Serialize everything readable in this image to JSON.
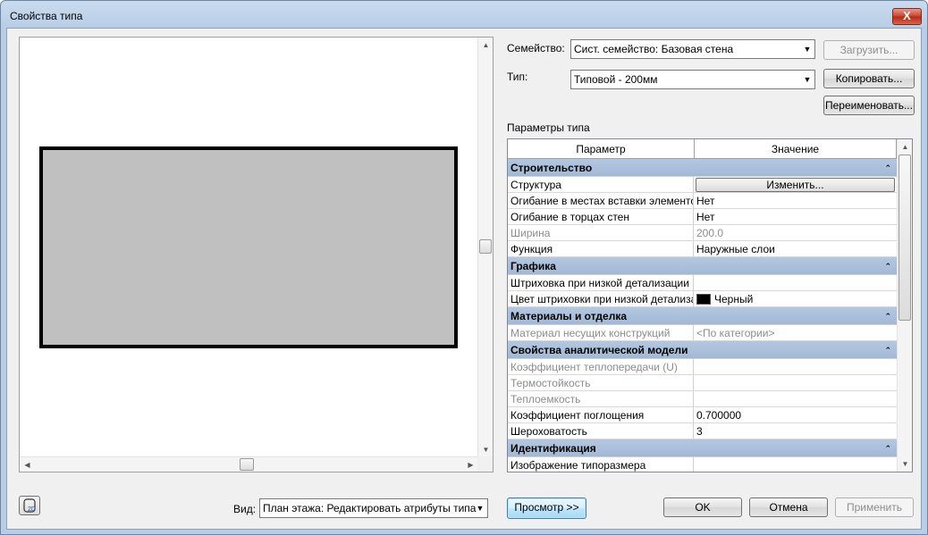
{
  "window": {
    "title": "Свойства типа",
    "close_glyph": "X"
  },
  "left": {
    "view_label": "Вид:",
    "view_value": "План этажа: Редактировать атрибуты типа",
    "preview_button": "Просмотр >>"
  },
  "right": {
    "family_label": "Семейство:",
    "family_value": "Сист. семейство: Базовая стена",
    "load_button": "Загрузить...",
    "type_label": "Тип:",
    "type_value": "Типовой - 200мм",
    "copy_button": "Копировать...",
    "rename_button": "Переименовать...",
    "params_label": "Параметры типа"
  },
  "grid": {
    "col_param": "Параметр",
    "col_value": "Значение",
    "groups": [
      {
        "title": "Строительство",
        "rows": [
          {
            "name": "Структура",
            "value": "Изменить...",
            "button": true
          },
          {
            "name": "Огибание в местах вставки элементов",
            "value": "Нет"
          },
          {
            "name": "Огибание в торцах стен",
            "value": "Нет"
          },
          {
            "name": "Ширина",
            "value": "200.0",
            "disabled": true
          },
          {
            "name": "Функция",
            "value": "Наружные слои"
          }
        ]
      },
      {
        "title": "Графика",
        "rows": [
          {
            "name": "Штриховка при низкой детализации",
            "value": ""
          },
          {
            "name": "Цвет штриховки при низкой детализации",
            "value": "Черный",
            "swatch": true
          }
        ]
      },
      {
        "title": "Материалы и отделка",
        "rows": [
          {
            "name": "Материал несущих конструкций",
            "value": "<По категории>",
            "disabled": true
          }
        ]
      },
      {
        "title": "Свойства аналитической модели",
        "rows": [
          {
            "name": "Коэффициент теплопередачи (U)",
            "value": "",
            "disabled": true
          },
          {
            "name": "Термостойкость",
            "value": "",
            "disabled": true
          },
          {
            "name": "Теплоемкость",
            "value": "",
            "disabled": true
          },
          {
            "name": "Коэффициент поглощения",
            "value": "0.700000"
          },
          {
            "name": "Шероховатость",
            "value": "3"
          }
        ]
      },
      {
        "title": "Идентификация",
        "rows": [
          {
            "name": "Изображение типоразмера",
            "value": ""
          }
        ]
      }
    ]
  },
  "footer": {
    "ok": "OK",
    "cancel": "Отмена",
    "apply": "Применить"
  }
}
